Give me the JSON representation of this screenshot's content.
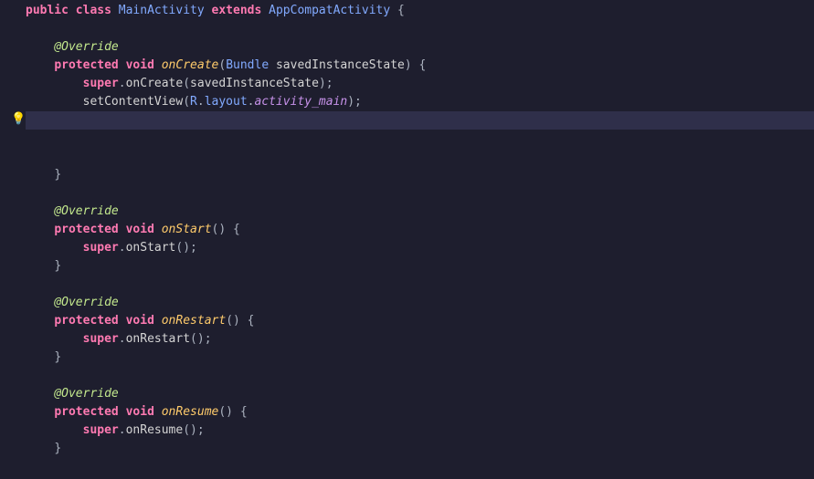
{
  "gutter": {
    "bulb_glyph": "💡"
  },
  "tokens": {
    "public": "public",
    "class": "class",
    "extends": "extends",
    "protected": "protected",
    "void": "void",
    "super": "super",
    "MainActivity": "MainActivity",
    "AppCompatActivity": "AppCompatActivity",
    "Override": "@Override",
    "onCreate": "onCreate",
    "onStart": "onStart",
    "onRestart": "onRestart",
    "onResume": "onResume",
    "Bundle": "Bundle",
    "savedInstanceState": "savedInstanceState",
    "setContentView": "setContentView",
    "R": "R",
    "layout": "layout",
    "activity_main": "activity_main",
    "lbrace": " {",
    "rbrace": "}",
    "lparen": "(",
    "rparen": ")",
    "rparen_semi": ");",
    "dot": ".",
    "empty_parens": "()",
    "space": " ",
    "indent1": "    ",
    "indent2": "        "
  }
}
